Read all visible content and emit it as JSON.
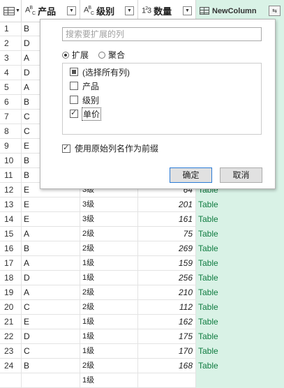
{
  "header": {
    "columns": [
      {
        "type_icon": "ABC",
        "name": "产品"
      },
      {
        "type_icon": "ABC",
        "name": "级别"
      },
      {
        "type_icon": "123",
        "name": "数量"
      },
      {
        "type_icon": "table",
        "name": "NewColumn"
      }
    ]
  },
  "rows": [
    {
      "idx": "1",
      "prod": "B",
      "lvl": "",
      "qty": "",
      "new": ""
    },
    {
      "idx": "2",
      "prod": "D",
      "lvl": "",
      "qty": "",
      "new": ""
    },
    {
      "idx": "3",
      "prod": "A",
      "lvl": "",
      "qty": "",
      "new": ""
    },
    {
      "idx": "4",
      "prod": "D",
      "lvl": "",
      "qty": "",
      "new": ""
    },
    {
      "idx": "5",
      "prod": "A",
      "lvl": "",
      "qty": "",
      "new": ""
    },
    {
      "idx": "6",
      "prod": "B",
      "lvl": "",
      "qty": "",
      "new": ""
    },
    {
      "idx": "7",
      "prod": "C",
      "lvl": "",
      "qty": "",
      "new": ""
    },
    {
      "idx": "8",
      "prod": "C",
      "lvl": "",
      "qty": "",
      "new": ""
    },
    {
      "idx": "9",
      "prod": "E",
      "lvl": "",
      "qty": "",
      "new": ""
    },
    {
      "idx": "10",
      "prod": "B",
      "lvl": "",
      "qty": "",
      "new": ""
    },
    {
      "idx": "11",
      "prod": "B",
      "lvl": "",
      "qty": "",
      "new": ""
    },
    {
      "idx": "12",
      "prod": "E",
      "lvl": "3级",
      "qty": "64",
      "new": "Table"
    },
    {
      "idx": "13",
      "prod": "E",
      "lvl": "3级",
      "qty": "201",
      "new": "Table"
    },
    {
      "idx": "14",
      "prod": "E",
      "lvl": "3级",
      "qty": "161",
      "new": "Table"
    },
    {
      "idx": "15",
      "prod": "A",
      "lvl": "2级",
      "qty": "75",
      "new": "Table"
    },
    {
      "idx": "16",
      "prod": "B",
      "lvl": "2级",
      "qty": "269",
      "new": "Table"
    },
    {
      "idx": "17",
      "prod": "A",
      "lvl": "1级",
      "qty": "159",
      "new": "Table"
    },
    {
      "idx": "18",
      "prod": "D",
      "lvl": "1级",
      "qty": "256",
      "new": "Table"
    },
    {
      "idx": "19",
      "prod": "A",
      "lvl": "2级",
      "qty": "210",
      "new": "Table"
    },
    {
      "idx": "20",
      "prod": "C",
      "lvl": "2级",
      "qty": "112",
      "new": "Table"
    },
    {
      "idx": "21",
      "prod": "E",
      "lvl": "1级",
      "qty": "162",
      "new": "Table"
    },
    {
      "idx": "22",
      "prod": "D",
      "lvl": "1级",
      "qty": "175",
      "new": "Table"
    },
    {
      "idx": "23",
      "prod": "C",
      "lvl": "1级",
      "qty": "170",
      "new": "Table"
    },
    {
      "idx": "24",
      "prod": "B",
      "lvl": "2级",
      "qty": "168",
      "new": "Table"
    },
    {
      "idx": "",
      "prod": "",
      "lvl": "1级",
      "qty": "",
      "new": ""
    }
  ],
  "popup": {
    "search_placeholder": "搜索要扩展的列",
    "radio_expand": "扩展",
    "radio_aggregate": "聚合",
    "selected_mode": "expand",
    "items": [
      {
        "label": "(选择所有列)",
        "state": "partial"
      },
      {
        "label": "产品",
        "state": "unchecked"
      },
      {
        "label": "级别",
        "state": "unchecked"
      },
      {
        "label": "单价",
        "state": "checked"
      }
    ],
    "prefix_label": "使用原始列名作为前缀",
    "prefix_checked": true,
    "ok_label": "确定",
    "cancel_label": "取消"
  },
  "colors": {
    "new_column_bg": "#d9f2e6",
    "table_link": "#107c41"
  }
}
